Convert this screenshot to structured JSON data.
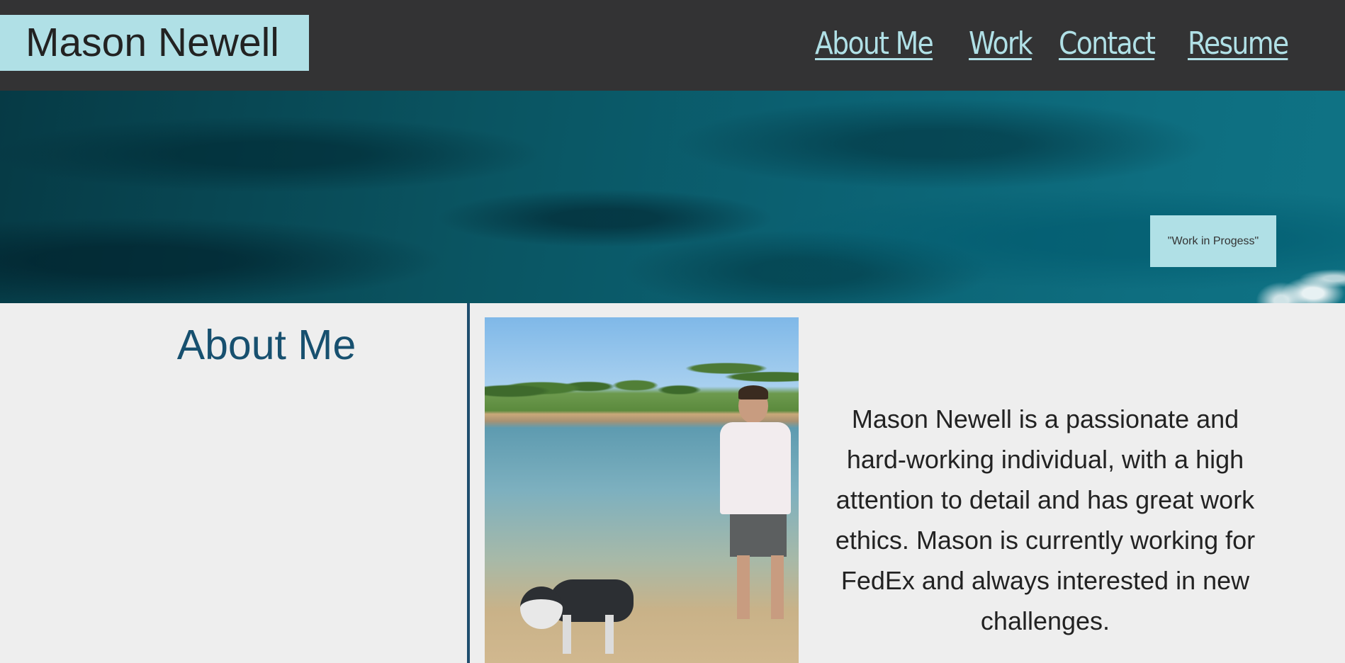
{
  "header": {
    "brand": "Mason Newell",
    "nav": [
      "About Me",
      "Work",
      "Contact",
      "Resume"
    ]
  },
  "hero": {
    "badge": "\"Work in Progess\""
  },
  "about": {
    "title": "About Me",
    "photo_alt": "Mason Newell standing in water with a husky",
    "bio": "Mason Newell is a passionate and hard-working individual, with a high attention to detail and has great work ethics. Mason is currently working for FedEx and always interested in new challenges."
  },
  "colors": {
    "header_bg": "#333334",
    "accent": "#b0e0e6",
    "title": "#17506f",
    "page_bg": "#eeeeee"
  }
}
